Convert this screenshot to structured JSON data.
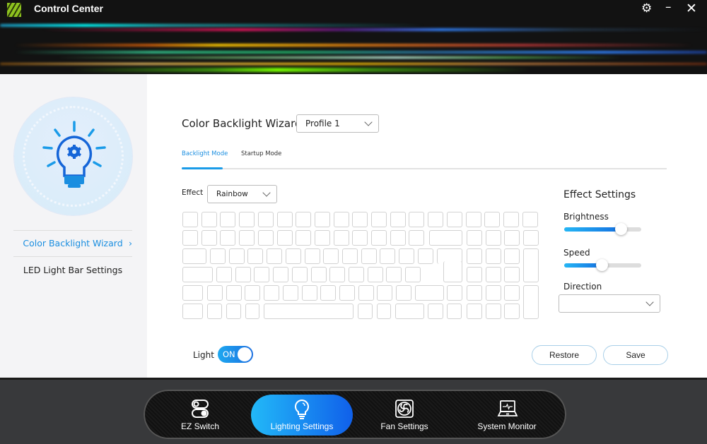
{
  "app": {
    "title": "Control Center"
  },
  "titlebar": {
    "settings_icon": "gear-icon",
    "minimize_icon": "minimize-icon",
    "close_icon": "close-icon"
  },
  "sidebar": {
    "items": [
      {
        "label": "Color Backlight Wizard",
        "active": true
      },
      {
        "label": "LED Light Bar Settings",
        "active": false
      }
    ]
  },
  "main": {
    "title": "Color Backlight Wizard",
    "profile": "Profile 1",
    "tabs": [
      {
        "label": "Backlight Mode",
        "active": true
      },
      {
        "label": "Startup Mode",
        "active": false
      }
    ],
    "effect_label": "Effect",
    "effect_value": "Rainbow",
    "effect_settings": {
      "title": "Effect Settings",
      "brightness_label": "Brightness",
      "brightness_percent": 73,
      "speed_label": "Speed",
      "speed_percent": 49,
      "direction_label": "Direction",
      "direction_value": ""
    },
    "light_label": "Light",
    "light_toggle": "ON",
    "restore_label": "Restore",
    "save_label": "Save"
  },
  "dock": {
    "items": [
      {
        "label": "EZ Switch",
        "icon": "toggle-switch-icon",
        "active": false
      },
      {
        "label": "Lighting Settings",
        "icon": "lightbulb-icon",
        "active": true
      },
      {
        "label": "Fan Settings",
        "icon": "fan-icon",
        "active": false
      },
      {
        "label": "System Monitor",
        "icon": "laptop-monitor-icon",
        "active": false
      }
    ]
  },
  "colors": {
    "accent": "#1a9be8",
    "accent_dark": "#1470e0",
    "titlebar": "#121212",
    "dock": "#38393b"
  }
}
